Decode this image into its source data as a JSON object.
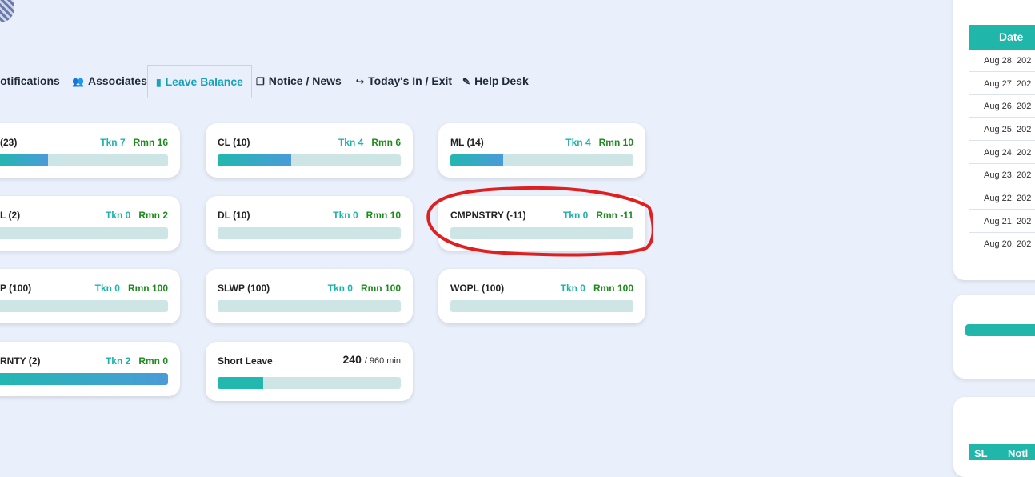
{
  "tabs": [
    {
      "label": "Notifications",
      "icon": "bell-icon"
    },
    {
      "label": "Associates",
      "icon": "users-icon"
    },
    {
      "label": "Leave Balance",
      "icon": "bar-chart-icon"
    },
    {
      "label": "Notice / News",
      "icon": "copy-icon"
    },
    {
      "label": "Today's In / Exit",
      "icon": "sign-out-icon"
    },
    {
      "label": "Help Desk",
      "icon": "edit-icon"
    }
  ],
  "leaves": [
    {
      "name": "(23)",
      "tkn": "Tkn 7",
      "rmn": "Rmn 16",
      "progress": 0.3
    },
    {
      "name": "CL (10)",
      "tkn": "Tkn 4",
      "rmn": "Rmn 6",
      "progress": 0.4
    },
    {
      "name": "ML (14)",
      "tkn": "Tkn 4",
      "rmn": "Rmn 10",
      "progress": 0.29
    },
    {
      "name": "L (2)",
      "tkn": "Tkn 0",
      "rmn": "Rmn 2",
      "progress": 0
    },
    {
      "name": "DL (10)",
      "tkn": "Tkn 0",
      "rmn": "Rmn 10",
      "progress": 0
    },
    {
      "name": "CMPNSTRY (-11)",
      "tkn": "Tkn 0",
      "rmn": "Rmn -11",
      "progress": 0
    },
    {
      "name": "P (100)",
      "tkn": "Tkn 0",
      "rmn": "Rmn 100",
      "progress": 0
    },
    {
      "name": "SLWP (100)",
      "tkn": "Tkn 0",
      "rmn": "Rmn 100",
      "progress": 0
    },
    {
      "name": "WOPL (100)",
      "tkn": "Tkn 0",
      "rmn": "Rmn 100",
      "progress": 0
    },
    {
      "name": "RNTY (2)",
      "tkn": "Tkn 2",
      "rmn": "Rmn 0",
      "progress": 1.0
    }
  ],
  "short_leave": {
    "label": "Short Leave",
    "used": "240",
    "total": "/ 960 min",
    "progress": 0.25
  },
  "attendance": {
    "header": "Date",
    "dates": [
      "Aug 28, 202",
      "Aug 27, 202",
      "Aug 26, 202",
      "Aug 25, 202",
      "Aug 24, 202",
      "Aug 23, 202",
      "Aug 22, 202",
      "Aug 21, 202",
      "Aug 20, 202"
    ]
  },
  "notice_table": {
    "col1": "SL",
    "col2": "Noti"
  },
  "colors": {
    "accent": "#20b6aa",
    "taken": "#20b2aa",
    "remaining": "#1e8a1e",
    "annotation": "#e02020"
  }
}
